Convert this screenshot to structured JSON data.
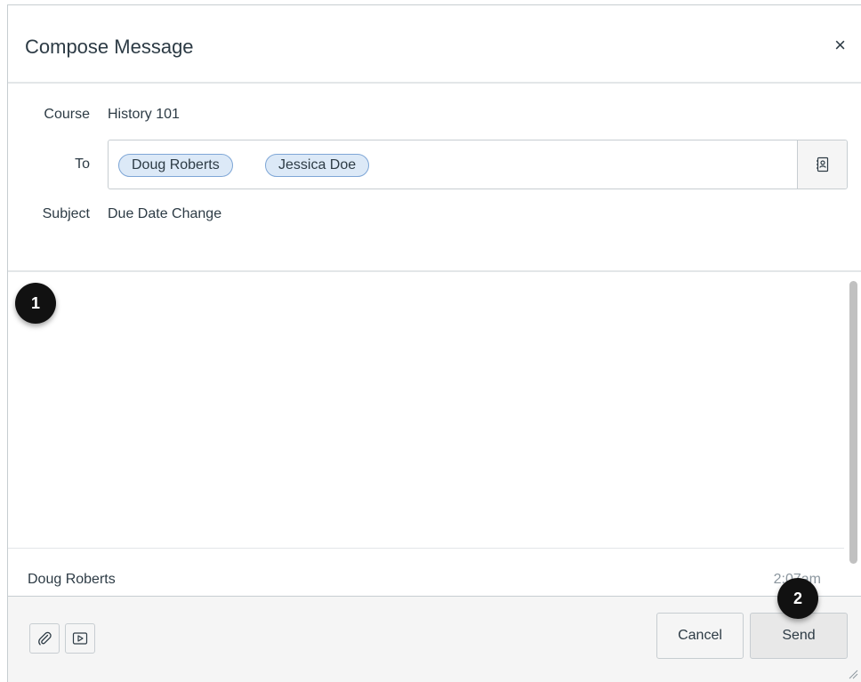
{
  "dialog": {
    "title": "Compose Message",
    "close_symbol": "×"
  },
  "fields": {
    "course": {
      "label": "Course",
      "value": "History 101"
    },
    "to": {
      "label": "To",
      "recipients": [
        "Doug Roberts",
        "Jessica Doe"
      ],
      "address_book_icon": "address-book-icon"
    },
    "subject": {
      "label": "Subject",
      "value": "Due Date Change"
    }
  },
  "body": {
    "value": ""
  },
  "previous_message": {
    "author": "Doug Roberts",
    "time": "2:07am"
  },
  "footer": {
    "attach_icon": "paperclip-icon",
    "media_icon": "media-icon",
    "cancel_label": "Cancel",
    "send_label": "Send"
  },
  "callouts": [
    "1",
    "2"
  ],
  "colors": {
    "token_bg": "#dce9f7",
    "token_border": "#7ea6d6",
    "text": "#2d3b45",
    "footer_bg": "#f5f5f5",
    "callout_bg": "#111111"
  }
}
